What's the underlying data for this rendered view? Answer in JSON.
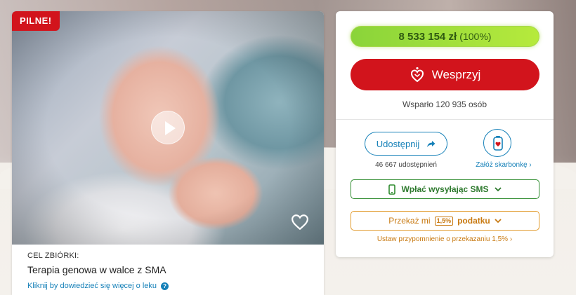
{
  "campaign": {
    "badge": "PILNE!",
    "goal_label": "CEL ZBIÓRKI:",
    "goal_title": "Terapia genowa w walce z SMA",
    "learn_more": "Kliknij by dowiedzieć się więcej o leku",
    "help_glyph": "?"
  },
  "donation": {
    "amount": "8 533 154 zł",
    "percent": "(100%)",
    "progress_fraction": 1.0,
    "support_label": "Wesprzyj",
    "supporters": "Wsparło 120 935 osób",
    "share_label": "Udostępnij",
    "share_count": "46 667 udostępnień",
    "piggy_label": "Załóż skarbonkę",
    "sms_label": "Wpłać wysyłając SMS",
    "tax_prefix": "Przekaż mi",
    "tax_badge": "1,5%",
    "tax_suffix": "podatku",
    "reminder": "Ustaw przypomnienie o przekazaniu 1,5%",
    "chevron": "›"
  },
  "colors": {
    "accent_red": "#d2141c",
    "progress_green": "#8ad43a",
    "link_blue": "#1580b8",
    "sms_green": "#2e7a2e",
    "tax_orange": "#c87a12"
  },
  "icons": [
    "play-icon",
    "heart-icon",
    "question-icon",
    "hand-heart-icon",
    "share-arrow-icon",
    "piggy-bank-icon",
    "phone-icon",
    "chevron-down-icon",
    "chevron-right-icon"
  ]
}
